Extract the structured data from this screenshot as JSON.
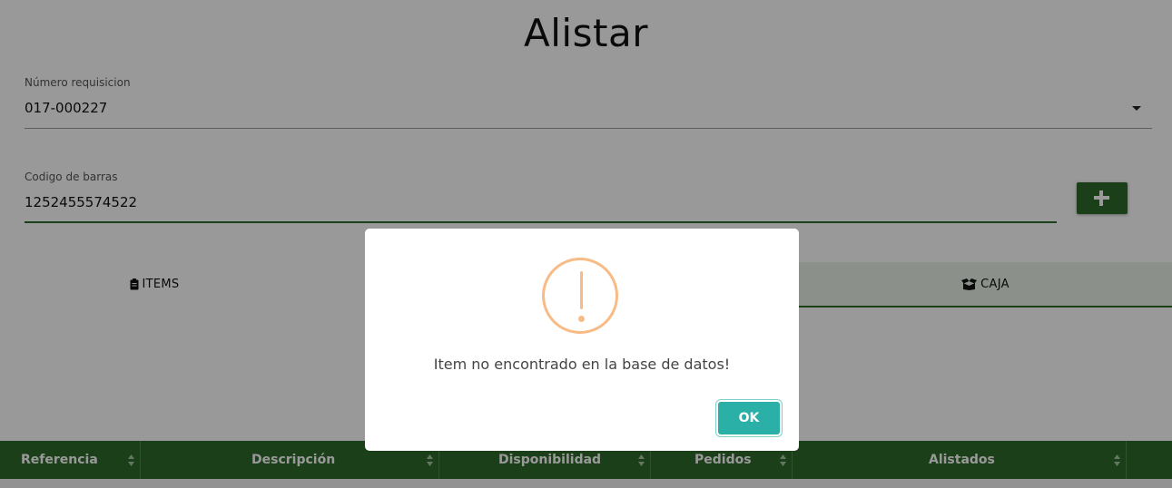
{
  "page": {
    "title": "Alistar"
  },
  "requisition": {
    "label": "Número requisicion",
    "value": "017-000227"
  },
  "barcode": {
    "label": "Codigo de barras",
    "value": "1252455574522"
  },
  "tabs": [
    {
      "label": "ITEMS",
      "icon": "clipboard-icon"
    },
    {
      "label": "CAJA",
      "icon": "box-icon"
    }
  ],
  "table": {
    "columns": [
      "Referencia",
      "Descripción",
      "Disponibilidad",
      "Pedidos",
      "Alistados"
    ]
  },
  "dialog": {
    "icon": "warning-icon",
    "message": "Item no encontrado en la base de datos!",
    "ok_label": "OK"
  },
  "colors": {
    "primary_green": "#2e6b2b",
    "warning_orange": "#f8bb86",
    "ok_button_teal": "#2ab0a6"
  }
}
